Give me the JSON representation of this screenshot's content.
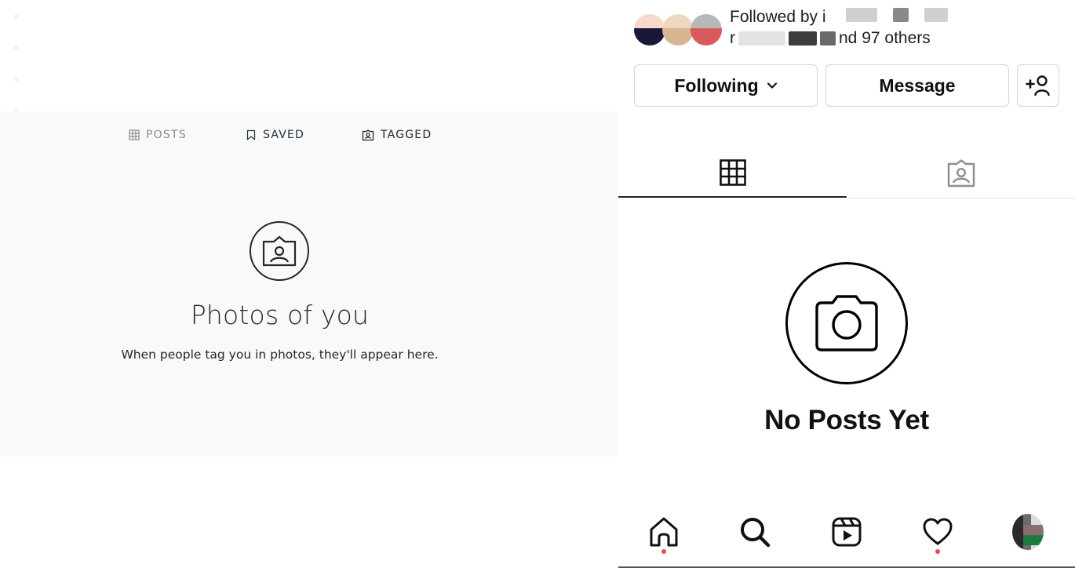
{
  "web": {
    "tabs": [
      {
        "label": "POSTS",
        "icon": "grid-icon",
        "state": "inactive"
      },
      {
        "label": "SAVED",
        "icon": "bookmark-icon",
        "state": "inactive"
      },
      {
        "label": "TAGGED",
        "icon": "tagged-icon",
        "state": "active"
      }
    ],
    "empty_state": {
      "icon": "tagged-photo-icon",
      "title": "Photos of you",
      "subtitle": "When people tag you in photos, they'll appear here."
    }
  },
  "mobile": {
    "followed_by": {
      "line1_prefix": "Followed by i",
      "line2_prefix": "r",
      "line2_suffix": "nd 97 others"
    },
    "buttons": {
      "following": "Following",
      "message": "Message",
      "add_user_icon": "add-user-icon"
    },
    "tabs": [
      {
        "icon": "grid-icon",
        "state": "active"
      },
      {
        "icon": "tagged-icon",
        "state": "inactive"
      }
    ],
    "empty_state": {
      "icon": "camera-icon",
      "title": "No Posts Yet"
    },
    "bottom_nav": [
      {
        "icon": "home-icon",
        "notification_dot": true
      },
      {
        "icon": "search-icon",
        "notification_dot": false
      },
      {
        "icon": "reels-icon",
        "notification_dot": false
      },
      {
        "icon": "heart-icon",
        "notification_dot": true
      },
      {
        "icon": "profile-avatar",
        "notification_dot": false
      }
    ],
    "colors": {
      "notification_dot": "#ed4956"
    }
  }
}
